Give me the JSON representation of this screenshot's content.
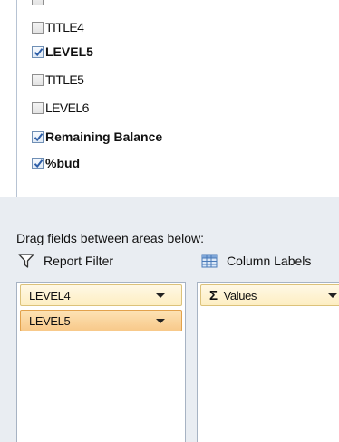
{
  "field_list": {
    "fields": [
      {
        "label": "",
        "checked": false,
        "bold": false
      },
      {
        "label": "TITLE4",
        "checked": false,
        "bold": false
      },
      {
        "label": "LEVEL5",
        "checked": true,
        "bold": true
      },
      {
        "label": "TITLE5",
        "checked": false,
        "bold": false
      },
      {
        "label": "LEVEL6",
        "checked": false,
        "bold": false
      },
      {
        "label": "Remaining Balance",
        "checked": true,
        "bold": true
      },
      {
        "label": "%bud",
        "checked": true,
        "bold": true
      }
    ]
  },
  "areas": {
    "instruction": "Drag fields between areas below:",
    "report_filter": {
      "label": "Report Filter",
      "icon": "filter-icon",
      "items": [
        "LEVEL4",
        "LEVEL5"
      ]
    },
    "column_labels": {
      "label": "Column Labels",
      "icon": "table-grid-icon",
      "items": [
        "Values"
      ]
    }
  },
  "colors": {
    "pane_bg": "#e9edf2",
    "pill_bg": "#fdeec2",
    "pill_active_bg": "#f8c98a",
    "checkmark": "#2e5fa8"
  }
}
